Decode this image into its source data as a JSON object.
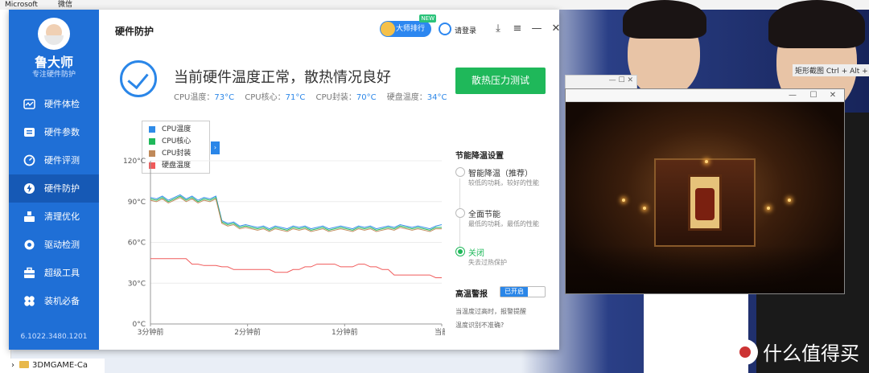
{
  "taskbar": {
    "item1": "Microsoft",
    "item2": "微信"
  },
  "explorer": {
    "folder_label": "3DMGAME-Ca"
  },
  "snip_hint": "矩形截图 Ctrl + Alt + A",
  "watermark": "什么值得买",
  "app": {
    "brand": "鲁大师",
    "slogan": "专注硬件防护",
    "version": "6.1022.3480.1201",
    "nav": [
      {
        "label": "硬件体检"
      },
      {
        "label": "硬件参数"
      },
      {
        "label": "硬件评测"
      },
      {
        "label": "硬件防护"
      },
      {
        "label": "清理优化"
      },
      {
        "label": "驱动检测"
      },
      {
        "label": "超级工具"
      },
      {
        "label": "装机必备"
      }
    ],
    "header": {
      "title": "硬件防护",
      "master_label": "大师排行",
      "new_badge": "NEW",
      "login": "请登录"
    },
    "status": {
      "title": "当前硬件温度正常，散热情况良好",
      "cpu_temp_label": "CPU温度：",
      "cpu_temp": "73°C",
      "cpu_core_label": "CPU核心：",
      "cpu_core": "71°C",
      "cpu_pkg_label": "CPU封装：",
      "cpu_pkg": "70°C",
      "disk_label": "硬盘温度：",
      "disk": "34°C"
    },
    "stress_button": "散热压力测试",
    "energy": {
      "title": "节能降温设置",
      "options": [
        {
          "label": "智能降温（推荐）",
          "desc": "较低的功耗，较好的性能"
        },
        {
          "label": "全面节能",
          "desc": "最低的功耗，最低的性能"
        },
        {
          "label": "关闭",
          "desc": "失去过热保护"
        }
      ]
    },
    "alarm": {
      "title": "高温警报",
      "toggle": "已开启",
      "note1": "当温度过高时，报警提醒",
      "note2": "温度识别不准确?"
    }
  },
  "colors": {
    "cpu_temp": "#2f8be8",
    "cpu_core": "#1fb85a",
    "cpu_pkg": "#c08a5a",
    "disk": "#f05a5a",
    "accent": "#2a86e8"
  },
  "chart_data": {
    "type": "line",
    "ylim": [
      0,
      120
    ],
    "yticks": [
      "0°C",
      "30°C",
      "60°C",
      "90°C",
      "120°C"
    ],
    "xticks": [
      "3分钟前",
      "2分钟前",
      "1分钟前",
      "当前"
    ],
    "series": [
      {
        "name": "CPU温度",
        "values": [
          93,
          92,
          94,
          91,
          93,
          95,
          92,
          94,
          91,
          93,
          92,
          94,
          76,
          74,
          75,
          72,
          73,
          72,
          71,
          72,
          70,
          72,
          71,
          70,
          72,
          71,
          72,
          70,
          71,
          72,
          70,
          71,
          72,
          71,
          70,
          72,
          71,
          72,
          70,
          71,
          72,
          71,
          73,
          72,
          71,
          72,
          71,
          70,
          72,
          73
        ]
      },
      {
        "name": "CPU核心",
        "values": [
          92,
          91,
          93,
          90,
          92,
          94,
          91,
          93,
          90,
          92,
          91,
          93,
          75,
          73,
          74,
          71,
          72,
          71,
          70,
          71,
          69,
          71,
          70,
          69,
          71,
          70,
          71,
          69,
          70,
          71,
          69,
          70,
          71,
          70,
          69,
          71,
          70,
          71,
          69,
          70,
          71,
          70,
          72,
          71,
          70,
          71,
          70,
          69,
          71,
          71
        ]
      },
      {
        "name": "CPU封装",
        "values": [
          91,
          90,
          92,
          89,
          91,
          93,
          90,
          92,
          89,
          91,
          90,
          92,
          74,
          72,
          73,
          70,
          71,
          70,
          69,
          70,
          68,
          70,
          69,
          68,
          70,
          69,
          70,
          68,
          69,
          70,
          68,
          69,
          70,
          69,
          68,
          70,
          69,
          70,
          68,
          69,
          70,
          69,
          71,
          70,
          69,
          70,
          69,
          68,
          70,
          70
        ]
      },
      {
        "name": "硬盘温度",
        "values": [
          48,
          48,
          48,
          48,
          48,
          48,
          48,
          44,
          44,
          43,
          43,
          43,
          42,
          42,
          40,
          40,
          40,
          40,
          40,
          40,
          40,
          38,
          38,
          38,
          40,
          40,
          42,
          42,
          44,
          44,
          44,
          44,
          42,
          42,
          42,
          44,
          44,
          42,
          42,
          40,
          40,
          36,
          36,
          36,
          36,
          36,
          36,
          36,
          34,
          34
        ]
      }
    ]
  }
}
